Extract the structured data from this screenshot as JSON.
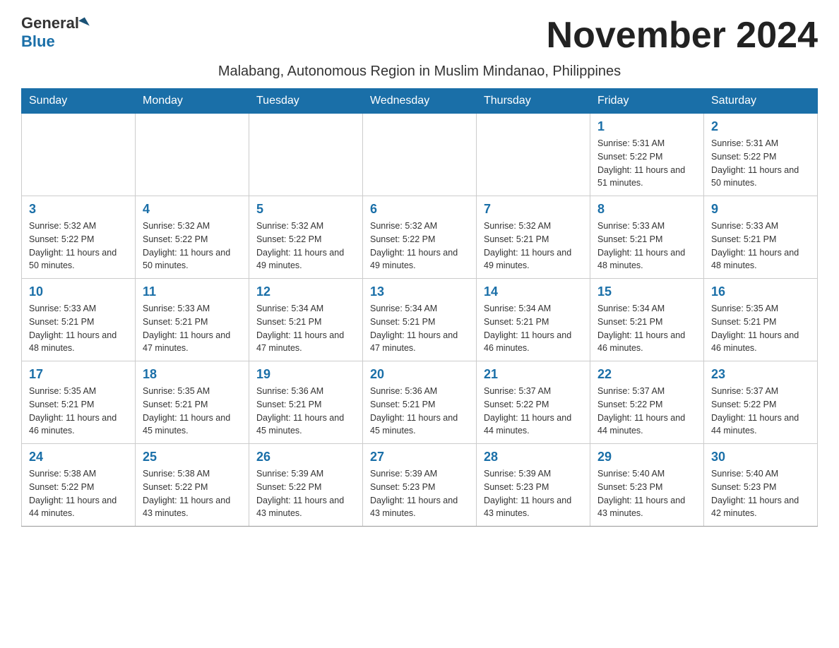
{
  "logo": {
    "general": "General",
    "blue": "Blue"
  },
  "title": "November 2024",
  "subtitle": "Malabang, Autonomous Region in Muslim Mindanao, Philippines",
  "days_of_week": [
    "Sunday",
    "Monday",
    "Tuesday",
    "Wednesday",
    "Thursday",
    "Friday",
    "Saturday"
  ],
  "weeks": [
    [
      {
        "day": "",
        "info": ""
      },
      {
        "day": "",
        "info": ""
      },
      {
        "day": "",
        "info": ""
      },
      {
        "day": "",
        "info": ""
      },
      {
        "day": "",
        "info": ""
      },
      {
        "day": "1",
        "info": "Sunrise: 5:31 AM\nSunset: 5:22 PM\nDaylight: 11 hours and 51 minutes."
      },
      {
        "day": "2",
        "info": "Sunrise: 5:31 AM\nSunset: 5:22 PM\nDaylight: 11 hours and 50 minutes."
      }
    ],
    [
      {
        "day": "3",
        "info": "Sunrise: 5:32 AM\nSunset: 5:22 PM\nDaylight: 11 hours and 50 minutes."
      },
      {
        "day": "4",
        "info": "Sunrise: 5:32 AM\nSunset: 5:22 PM\nDaylight: 11 hours and 50 minutes."
      },
      {
        "day": "5",
        "info": "Sunrise: 5:32 AM\nSunset: 5:22 PM\nDaylight: 11 hours and 49 minutes."
      },
      {
        "day": "6",
        "info": "Sunrise: 5:32 AM\nSunset: 5:22 PM\nDaylight: 11 hours and 49 minutes."
      },
      {
        "day": "7",
        "info": "Sunrise: 5:32 AM\nSunset: 5:21 PM\nDaylight: 11 hours and 49 minutes."
      },
      {
        "day": "8",
        "info": "Sunrise: 5:33 AM\nSunset: 5:21 PM\nDaylight: 11 hours and 48 minutes."
      },
      {
        "day": "9",
        "info": "Sunrise: 5:33 AM\nSunset: 5:21 PM\nDaylight: 11 hours and 48 minutes."
      }
    ],
    [
      {
        "day": "10",
        "info": "Sunrise: 5:33 AM\nSunset: 5:21 PM\nDaylight: 11 hours and 48 minutes."
      },
      {
        "day": "11",
        "info": "Sunrise: 5:33 AM\nSunset: 5:21 PM\nDaylight: 11 hours and 47 minutes."
      },
      {
        "day": "12",
        "info": "Sunrise: 5:34 AM\nSunset: 5:21 PM\nDaylight: 11 hours and 47 minutes."
      },
      {
        "day": "13",
        "info": "Sunrise: 5:34 AM\nSunset: 5:21 PM\nDaylight: 11 hours and 47 minutes."
      },
      {
        "day": "14",
        "info": "Sunrise: 5:34 AM\nSunset: 5:21 PM\nDaylight: 11 hours and 46 minutes."
      },
      {
        "day": "15",
        "info": "Sunrise: 5:34 AM\nSunset: 5:21 PM\nDaylight: 11 hours and 46 minutes."
      },
      {
        "day": "16",
        "info": "Sunrise: 5:35 AM\nSunset: 5:21 PM\nDaylight: 11 hours and 46 minutes."
      }
    ],
    [
      {
        "day": "17",
        "info": "Sunrise: 5:35 AM\nSunset: 5:21 PM\nDaylight: 11 hours and 46 minutes."
      },
      {
        "day": "18",
        "info": "Sunrise: 5:35 AM\nSunset: 5:21 PM\nDaylight: 11 hours and 45 minutes."
      },
      {
        "day": "19",
        "info": "Sunrise: 5:36 AM\nSunset: 5:21 PM\nDaylight: 11 hours and 45 minutes."
      },
      {
        "day": "20",
        "info": "Sunrise: 5:36 AM\nSunset: 5:21 PM\nDaylight: 11 hours and 45 minutes."
      },
      {
        "day": "21",
        "info": "Sunrise: 5:37 AM\nSunset: 5:22 PM\nDaylight: 11 hours and 44 minutes."
      },
      {
        "day": "22",
        "info": "Sunrise: 5:37 AM\nSunset: 5:22 PM\nDaylight: 11 hours and 44 minutes."
      },
      {
        "day": "23",
        "info": "Sunrise: 5:37 AM\nSunset: 5:22 PM\nDaylight: 11 hours and 44 minutes."
      }
    ],
    [
      {
        "day": "24",
        "info": "Sunrise: 5:38 AM\nSunset: 5:22 PM\nDaylight: 11 hours and 44 minutes."
      },
      {
        "day": "25",
        "info": "Sunrise: 5:38 AM\nSunset: 5:22 PM\nDaylight: 11 hours and 43 minutes."
      },
      {
        "day": "26",
        "info": "Sunrise: 5:39 AM\nSunset: 5:22 PM\nDaylight: 11 hours and 43 minutes."
      },
      {
        "day": "27",
        "info": "Sunrise: 5:39 AM\nSunset: 5:23 PM\nDaylight: 11 hours and 43 minutes."
      },
      {
        "day": "28",
        "info": "Sunrise: 5:39 AM\nSunset: 5:23 PM\nDaylight: 11 hours and 43 minutes."
      },
      {
        "day": "29",
        "info": "Sunrise: 5:40 AM\nSunset: 5:23 PM\nDaylight: 11 hours and 43 minutes."
      },
      {
        "day": "30",
        "info": "Sunrise: 5:40 AM\nSunset: 5:23 PM\nDaylight: 11 hours and 42 minutes."
      }
    ]
  ]
}
